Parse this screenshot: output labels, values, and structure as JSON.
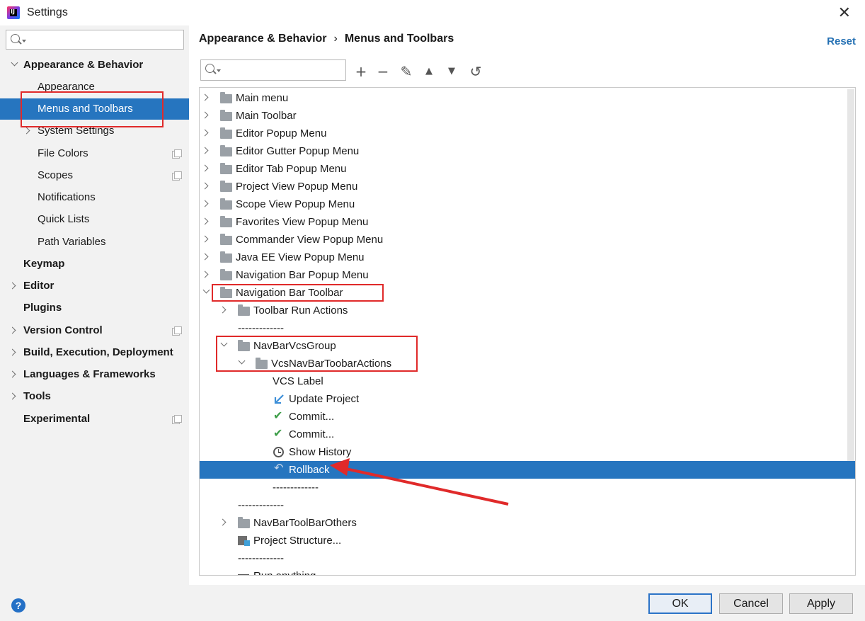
{
  "window": {
    "title": "Settings",
    "close_glyph": "✕"
  },
  "sidebar": {
    "search_placeholder": "",
    "items": [
      {
        "label": "Appearance & Behavior",
        "bold": true,
        "expanded": true
      },
      {
        "label": "Appearance"
      },
      {
        "label": "Menus and Toolbars",
        "selected": true
      },
      {
        "label": "System Settings"
      },
      {
        "label": "File Colors"
      },
      {
        "label": "Scopes"
      },
      {
        "label": "Notifications"
      },
      {
        "label": "Quick Lists"
      },
      {
        "label": "Path Variables"
      },
      {
        "label": "Keymap",
        "bold": true
      },
      {
        "label": "Editor",
        "bold": true
      },
      {
        "label": "Plugins",
        "bold": true
      },
      {
        "label": "Version Control",
        "bold": true
      },
      {
        "label": "Build, Execution, Deployment",
        "bold": true
      },
      {
        "label": "Languages & Frameworks",
        "bold": true
      },
      {
        "label": "Tools",
        "bold": true
      },
      {
        "label": "Experimental",
        "bold": true
      }
    ]
  },
  "main": {
    "breadcrumb": [
      "Appearance & Behavior",
      "Menus and Toolbars"
    ],
    "breadcrumb_sep": "›",
    "reset_label": "Reset",
    "toolbar": {
      "add_glyph": "+",
      "remove_glyph": "−",
      "edit_glyph": "✎",
      "up_glyph": "▲",
      "down_glyph": "▼",
      "restore_glyph": "↺"
    },
    "tree": [
      {
        "label": "Main menu"
      },
      {
        "label": "Main Toolbar"
      },
      {
        "label": "Editor Popup Menu"
      },
      {
        "label": "Editor Gutter Popup Menu"
      },
      {
        "label": "Editor Tab Popup Menu"
      },
      {
        "label": "Project View Popup Menu"
      },
      {
        "label": "Scope View Popup Menu"
      },
      {
        "label": "Favorites View Popup Menu"
      },
      {
        "label": "Commander View Popup Menu"
      },
      {
        "label": "Java EE View Popup Menu"
      },
      {
        "label": "Navigation Bar Popup Menu"
      },
      {
        "label": "Navigation Bar Toolbar"
      },
      {
        "label": "Toolbar Run Actions"
      },
      {
        "label": "-------------"
      },
      {
        "label": "NavBarVcsGroup"
      },
      {
        "label": "VcsNavBarToobarActions"
      },
      {
        "label": "VCS Label"
      },
      {
        "label": "Update Project"
      },
      {
        "label": "Commit..."
      },
      {
        "label": "Commit..."
      },
      {
        "label": "Show History"
      },
      {
        "label": "Rollback",
        "selected": true
      },
      {
        "label": "-------------"
      },
      {
        "label": "-------------"
      },
      {
        "label": "NavBarToolBarOthers"
      },
      {
        "label": "Project Structure..."
      },
      {
        "label": "-------------"
      },
      {
        "label": "Run anything"
      }
    ],
    "icons": {
      "check_glyph": "✔",
      "rollback_glyph": "↶"
    }
  },
  "footer": {
    "help_label": "?",
    "ok_label": "OK",
    "cancel_label": "Cancel",
    "apply_label": "Apply"
  },
  "colors": {
    "selection": "#2675bf",
    "annotation_red": "#e02a2a",
    "link": "#2470b3"
  }
}
